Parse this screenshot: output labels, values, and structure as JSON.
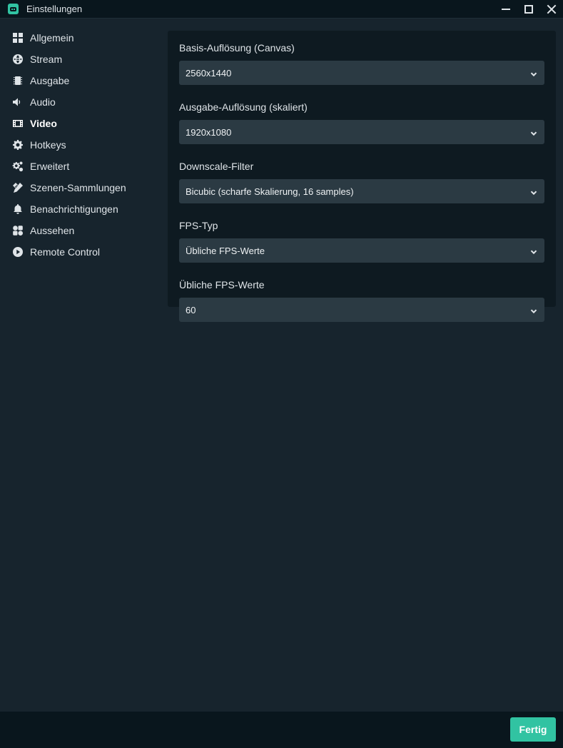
{
  "window": {
    "title": "Einstellungen",
    "controls": {
      "minimize_icon": "minimize-icon",
      "maximize_icon": "maximize-icon",
      "close_icon": "close-icon"
    }
  },
  "sidebar": {
    "items": [
      {
        "label": "Allgemein",
        "icon": "grid-icon",
        "active": false
      },
      {
        "label": "Stream",
        "icon": "globe-icon",
        "active": false
      },
      {
        "label": "Ausgabe",
        "icon": "chip-icon",
        "active": false
      },
      {
        "label": "Audio",
        "icon": "speaker-icon",
        "active": false
      },
      {
        "label": "Video",
        "icon": "film-icon",
        "active": true
      },
      {
        "label": "Hotkeys",
        "icon": "gear-icon",
        "active": false
      },
      {
        "label": "Erweitert",
        "icon": "gears-icon",
        "active": false
      },
      {
        "label": "Szenen-Sammlungen",
        "icon": "pencil-ruler-icon",
        "active": false
      },
      {
        "label": "Benachrichtigungen",
        "icon": "bell-icon",
        "active": false
      },
      {
        "label": "Aussehen",
        "icon": "shapes-icon",
        "active": false
      },
      {
        "label": "Remote Control",
        "icon": "play-circle-icon",
        "active": false
      }
    ]
  },
  "video": {
    "fields": [
      {
        "label": "Basis-Auflösung (Canvas)",
        "value": "2560x1440"
      },
      {
        "label": "Ausgabe-Auflösung (skaliert)",
        "value": "1920x1080"
      },
      {
        "label": "Downscale-Filter",
        "value": "Bicubic (scharfe Skalierung, 16 samples)"
      },
      {
        "label": "FPS-Typ",
        "value": "Übliche FPS-Werte"
      },
      {
        "label": "Übliche FPS-Werte",
        "value": "60"
      }
    ]
  },
  "footer": {
    "done_label": "Fertig"
  },
  "colors": {
    "accent": "#31c3a2",
    "background": "#17242d",
    "panel": "#0e1a21",
    "select": "#2b3a43"
  }
}
